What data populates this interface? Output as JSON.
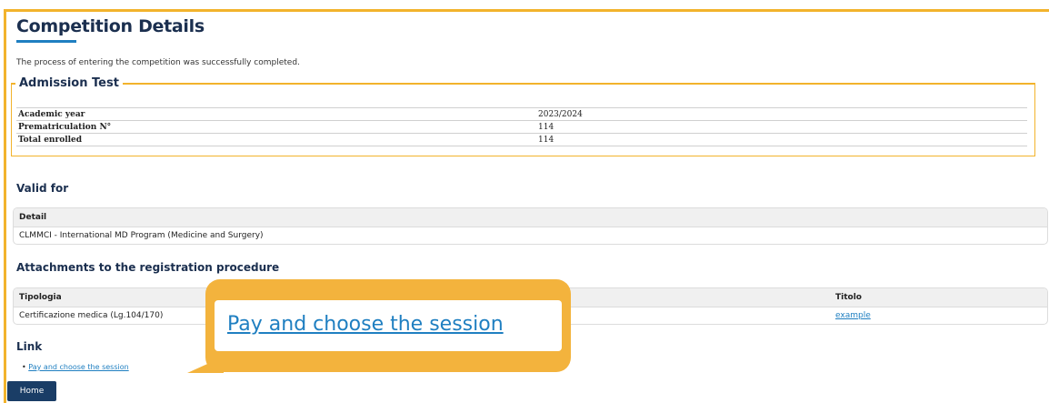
{
  "page": {
    "title": "Competition Details",
    "intro": "The process of entering the competition was successfully completed."
  },
  "admission": {
    "legend": "Admission Test",
    "rows": [
      {
        "label": "Academic year",
        "value": "2023/2024"
      },
      {
        "label": "Prematriculation N°",
        "value": "114"
      },
      {
        "label": "Total enrolled",
        "value": "114"
      }
    ]
  },
  "valid_for": {
    "heading": "Valid for",
    "header": "Detail",
    "row": "CLMMCI - International MD Program (Medicine and Surgery)"
  },
  "attachments": {
    "heading": "Attachments to the registration procedure",
    "headers": [
      "Tipologia",
      "Titolo"
    ],
    "row": {
      "tipologia": "Certificazione medica (Lg.104/170)",
      "titolo": "example"
    }
  },
  "links": {
    "heading": "Link",
    "items": [
      "Pay and choose the session"
    ]
  },
  "home_button": "Home",
  "callout": {
    "text": "Pay and choose the session"
  },
  "colors": {
    "accent": "#f2b32c",
    "link": "#1f7fc1",
    "navy": "#1b2f4f",
    "button": "#1a3d66"
  }
}
